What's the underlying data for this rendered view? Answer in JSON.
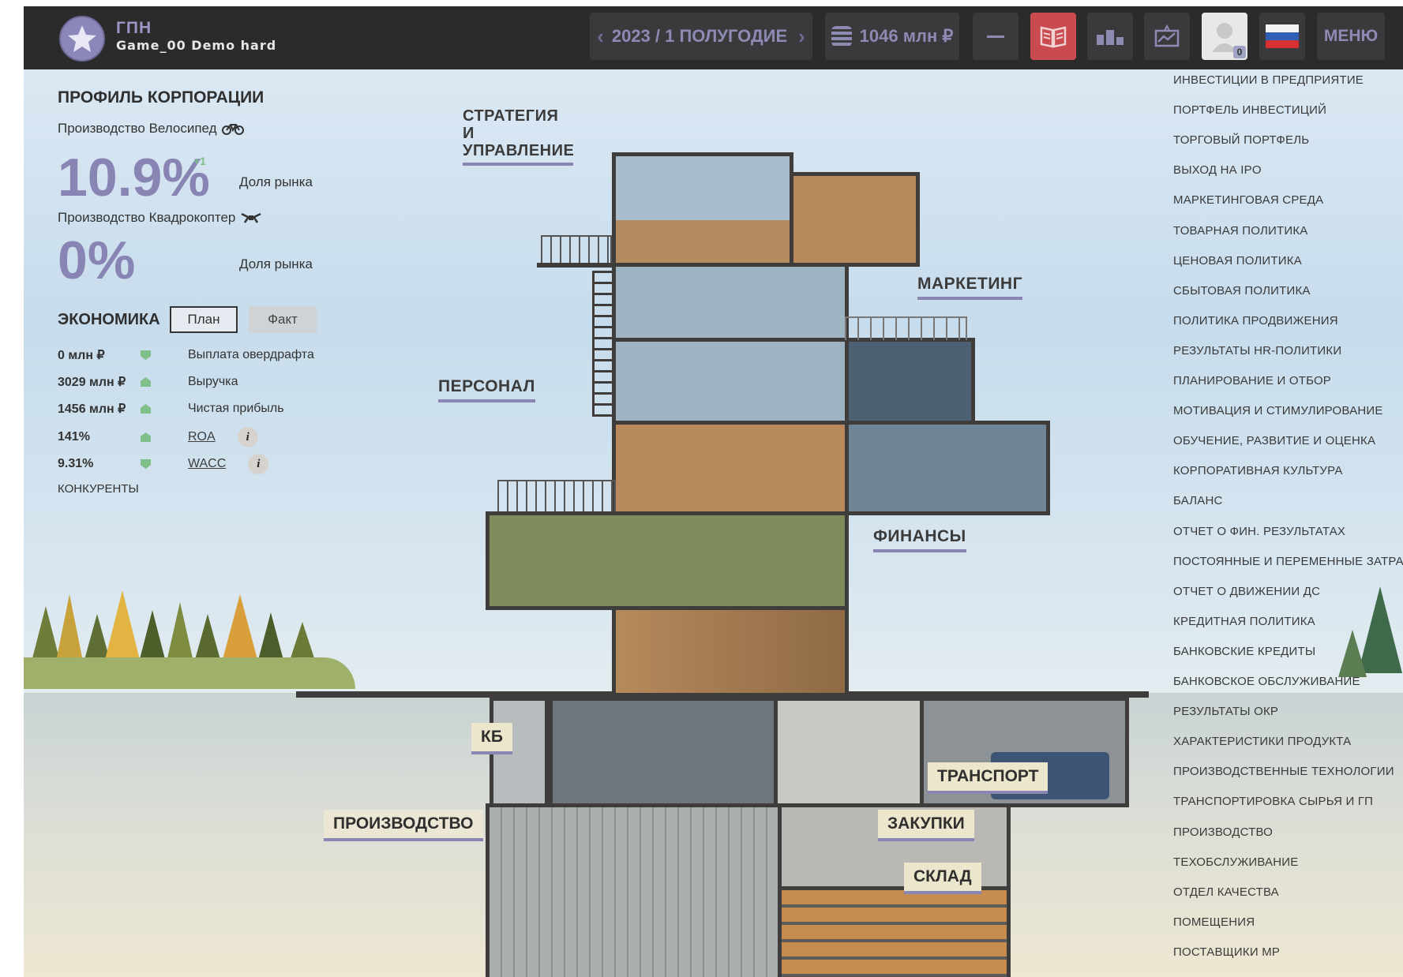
{
  "header": {
    "company_short": "ГПН",
    "game_name": "Game_00 Demo hard",
    "period": "2023 / 1 ПОЛУГОДИЕ",
    "cash": "1046 млн ₽",
    "notifications_count": "0",
    "menu_label": "МЕНЮ",
    "colors": {
      "bar": "#2b2b2c",
      "button": "#3a3a3c",
      "accent": "#8d8ab4",
      "active": "#c94a4f"
    }
  },
  "profile": {
    "title": "ПРОФИЛЬ КОРПОРАЦИИ",
    "products": [
      {
        "label": "Производство Велосипед",
        "icon": "bicycle-icon",
        "share": "10.9%",
        "delta": "+1",
        "share_label": "Доля рынка"
      },
      {
        "label": "Производство Квадрокоптер",
        "icon": "drone-icon",
        "share": "0%",
        "share_label": "Доля рынка"
      }
    ]
  },
  "economy": {
    "title": "ЭКОНОМИКА",
    "tab_plan": "План",
    "tab_fact": "Факт",
    "rows": [
      {
        "value": "0 млн ₽",
        "trend": "down",
        "label": "Выплата овердрафта",
        "link": false
      },
      {
        "value": "3029 млн ₽",
        "trend": "up",
        "label": "Выручка",
        "link": false
      },
      {
        "value": "1456 млн ₽",
        "trend": "up",
        "label": "Чистая прибыль",
        "link": false
      },
      {
        "value": "141%",
        "trend": "up",
        "label": "ROA",
        "link": true
      },
      {
        "value": "9.31%",
        "trend": "down",
        "label": "WACC",
        "link": true
      }
    ],
    "info_glyph": "i",
    "competitors": "КОНКУРЕНТЫ"
  },
  "building_labels": {
    "strategy": "СТРАТЕГИЯ И УПРАВЛЕНИЕ",
    "marketing": "МАРКЕТИНГ",
    "personnel": "ПЕРСОНАЛ",
    "finance": "ФИНАНСЫ",
    "kb": "КБ",
    "transport": "ТРАНСПОРТ",
    "production": "ПРОИЗВОДСТВО",
    "purchasing": "ЗАКУПКИ",
    "warehouse": "СКЛАД"
  },
  "right_menu": [
    "ИНВЕСТИЦИИ В ПРЕДПРИЯТИЕ",
    "ПОРТФЕЛЬ ИНВЕСТИЦИЙ",
    "ТОРГОВЫЙ ПОРТФЕЛЬ",
    "ВЫХОД НА IPO",
    "МАРКЕТИНГОВАЯ СРЕДА",
    "ТОВАРНАЯ ПОЛИТИКА",
    "ЦЕНОВАЯ ПОЛИТИКА",
    "СБЫТОВАЯ ПОЛИТИКА",
    "ПОЛИТИКА ПРОДВИЖЕНИЯ",
    "РЕЗУЛЬТАТЫ HR-ПОЛИТИКИ",
    "ПЛАНИРОВАНИЕ И ОТБОР",
    "МОТИВАЦИЯ И СТИМУЛИРОВАНИЕ",
    "ОБУЧЕНИЕ, РАЗВИТИЕ И ОЦЕНКА",
    "КОРПОРАТИВНАЯ КУЛЬТУРА",
    "БАЛАНС",
    "ОТЧЕТ О ФИН. РЕЗУЛЬТАТАХ",
    "ПОСТОЯННЫЕ И ПЕРЕМЕННЫЕ ЗАТРАТЫ",
    "ОТЧЕТ О ДВИЖЕНИИ ДС",
    "КРЕДИТНАЯ ПОЛИТИКА",
    "БАНКОВСКИЕ КРЕДИТЫ",
    "БАНКОВСКОЕ ОБСЛУЖИВАНИЕ",
    "РЕЗУЛЬТАТЫ ОКР",
    "ХАРАКТЕРИСТИКИ ПРОДУКТА",
    "ПРОИЗВОДСТВЕННЫЕ ТЕХНОЛОГИИ",
    "ТРАНСПОРТИРОВКА СЫРЬЯ И ГП",
    "ПРОИЗВОДСТВО",
    "ТЕХОБСЛУЖИВАНИЕ",
    "ОТДЕЛ КАЧЕСТВА",
    "ПОМЕЩЕНИЯ",
    "ПОСТАВЩИКИ МР"
  ]
}
